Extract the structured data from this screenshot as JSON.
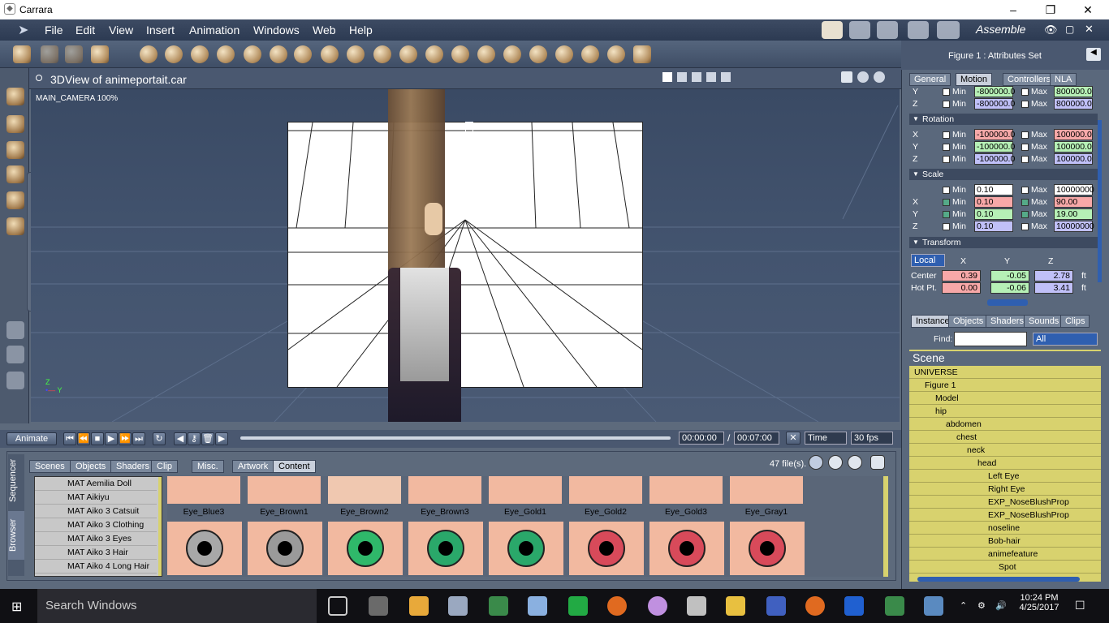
{
  "window": {
    "title": "Carrara"
  },
  "menu": [
    "File",
    "Edit",
    "View",
    "Insert",
    "Animation",
    "Windows",
    "Web",
    "Help"
  ],
  "room": "Assemble",
  "viewport": {
    "title": "3DView of animeportait.car",
    "camera": "MAIN_CAMERA 100%"
  },
  "animation": {
    "animate_label": "Animate",
    "time_current": "00:00:00",
    "time_end": "00:07:00",
    "time_mode": "Time",
    "fps": "30 fps"
  },
  "browser": {
    "side_tabs": [
      "Sequencer",
      "Browser"
    ],
    "tabs": [
      "Scenes",
      "Objects",
      "Shaders",
      "Clip",
      "Misc.",
      "Artwork",
      "Content"
    ],
    "active_tab": "Content",
    "file_count": "47 file(s).",
    "list": [
      "MAT Aemilia Doll",
      "MAT Aikiyu",
      "MAT Aiko 3 Catsuit",
      "MAT Aiko 3 Clothing",
      "MAT Aiko 3 Eyes",
      "MAT Aiko 3 Hair",
      "MAT Aiko 4 Long Hair"
    ],
    "thumbs_top": [
      "Eye_Blue3",
      "Eye_Brown1",
      "Eye_Brown2",
      "Eye_Brown3",
      "Eye_Gold1",
      "Eye_Gold2",
      "Eye_Gold3",
      "Eye_Gray1"
    ],
    "eye_colors": [
      "#a8a8a8",
      "#9a9a9a",
      "#2fb86a",
      "#2aa86a",
      "#2aa86a",
      "#d84a5a",
      "#d84a5a",
      "#d84a5a"
    ]
  },
  "attributes": {
    "title": "Figure 1 : Attributes Set",
    "tabs": [
      "General",
      "Motion",
      "Controllers",
      "NLA"
    ],
    "active_tab": "Motion",
    "position_rows": [
      {
        "axis": "Y",
        "min": "-800000.0",
        "max": "800000.0"
      },
      {
        "axis": "Z",
        "min": "-800000.0",
        "max": "800000.0"
      }
    ],
    "rotation_label": "Rotation",
    "rotation_rows": [
      {
        "axis": "X",
        "min": "-100000.0",
        "max": "100000.0"
      },
      {
        "axis": "Y",
        "min": "-100000.0",
        "max": "100000.0"
      },
      {
        "axis": "Z",
        "min": "-100000.0",
        "max": "100000.0"
      }
    ],
    "scale_label": "Scale",
    "scale_rows": [
      {
        "axis": "",
        "min": "0.10",
        "max": "10000000"
      },
      {
        "axis": "X",
        "min": "0.10",
        "max": "90.00"
      },
      {
        "axis": "Y",
        "min": "0.10",
        "max": "19.00"
      },
      {
        "axis": "Z",
        "min": "0.10",
        "max": "10000000"
      }
    ],
    "min_label": "Min",
    "max_label": "Max",
    "transform_label": "Transform",
    "space": "Local",
    "axes": [
      "X",
      "Y",
      "Z"
    ],
    "center_label": "Center",
    "center": [
      "0.39",
      "-0.05",
      "2.78"
    ],
    "hotpt_label": "Hot Pt.",
    "hotpt": [
      "0.00",
      "-0.06",
      "3.41"
    ],
    "unit": "ft"
  },
  "scene": {
    "tabs": [
      "Instance",
      "Objects",
      "Shaders",
      "Sounds",
      "Clips"
    ],
    "find_label": "Find:",
    "find_filter": "All",
    "header": "Scene",
    "tree": [
      {
        "label": "UNIVERSE",
        "depth": 0
      },
      {
        "label": "Figure 1",
        "depth": 1
      },
      {
        "label": "Model",
        "depth": 2
      },
      {
        "label": "hip",
        "depth": 2
      },
      {
        "label": "abdomen",
        "depth": 3
      },
      {
        "label": "chest",
        "depth": 4
      },
      {
        "label": "neck",
        "depth": 5
      },
      {
        "label": "head",
        "depth": 6
      },
      {
        "label": "Left Eye",
        "depth": 7
      },
      {
        "label": "Right Eye",
        "depth": 7
      },
      {
        "label": "EXP_NoseBlushProp",
        "depth": 7
      },
      {
        "label": "EXP_NoseBlushProp",
        "depth": 7
      },
      {
        "label": "noseline",
        "depth": 7
      },
      {
        "label": "Bob-hair",
        "depth": 7
      },
      {
        "label": "animefeature",
        "depth": 7
      },
      {
        "label": "Spot",
        "depth": 8
      }
    ]
  },
  "taskbar": {
    "search_placeholder": "Search Windows",
    "time": "10:24 PM",
    "date": "4/25/2017"
  }
}
